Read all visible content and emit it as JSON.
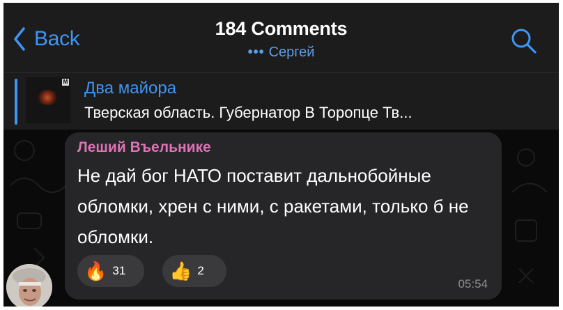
{
  "header": {
    "back_label": "Back",
    "title": "184 Comments",
    "typing_indicator": "•••",
    "subtitle": "Сергей",
    "search_icon": "search-icon"
  },
  "pinned": {
    "channel": "Два майора",
    "preview": "Тверская область. Губернатор В Торопце Тв..."
  },
  "message": {
    "author": "Леший Въельнике",
    "author_color": "#e071b6",
    "text": "Не дай бог НАТО поставит дальнобойные обломки, хрен с ними, с ракетами, только б не обломки.",
    "reactions": [
      {
        "emoji": "🔥",
        "icon": "fire-icon",
        "count": "31"
      },
      {
        "emoji": "👍",
        "icon": "thumbs-up-icon",
        "count": "2"
      }
    ],
    "time": "05:54"
  },
  "colors": {
    "accent": "#3e95f5",
    "header_bg": "#1c1c1d",
    "bubble_bg": "#262628"
  }
}
